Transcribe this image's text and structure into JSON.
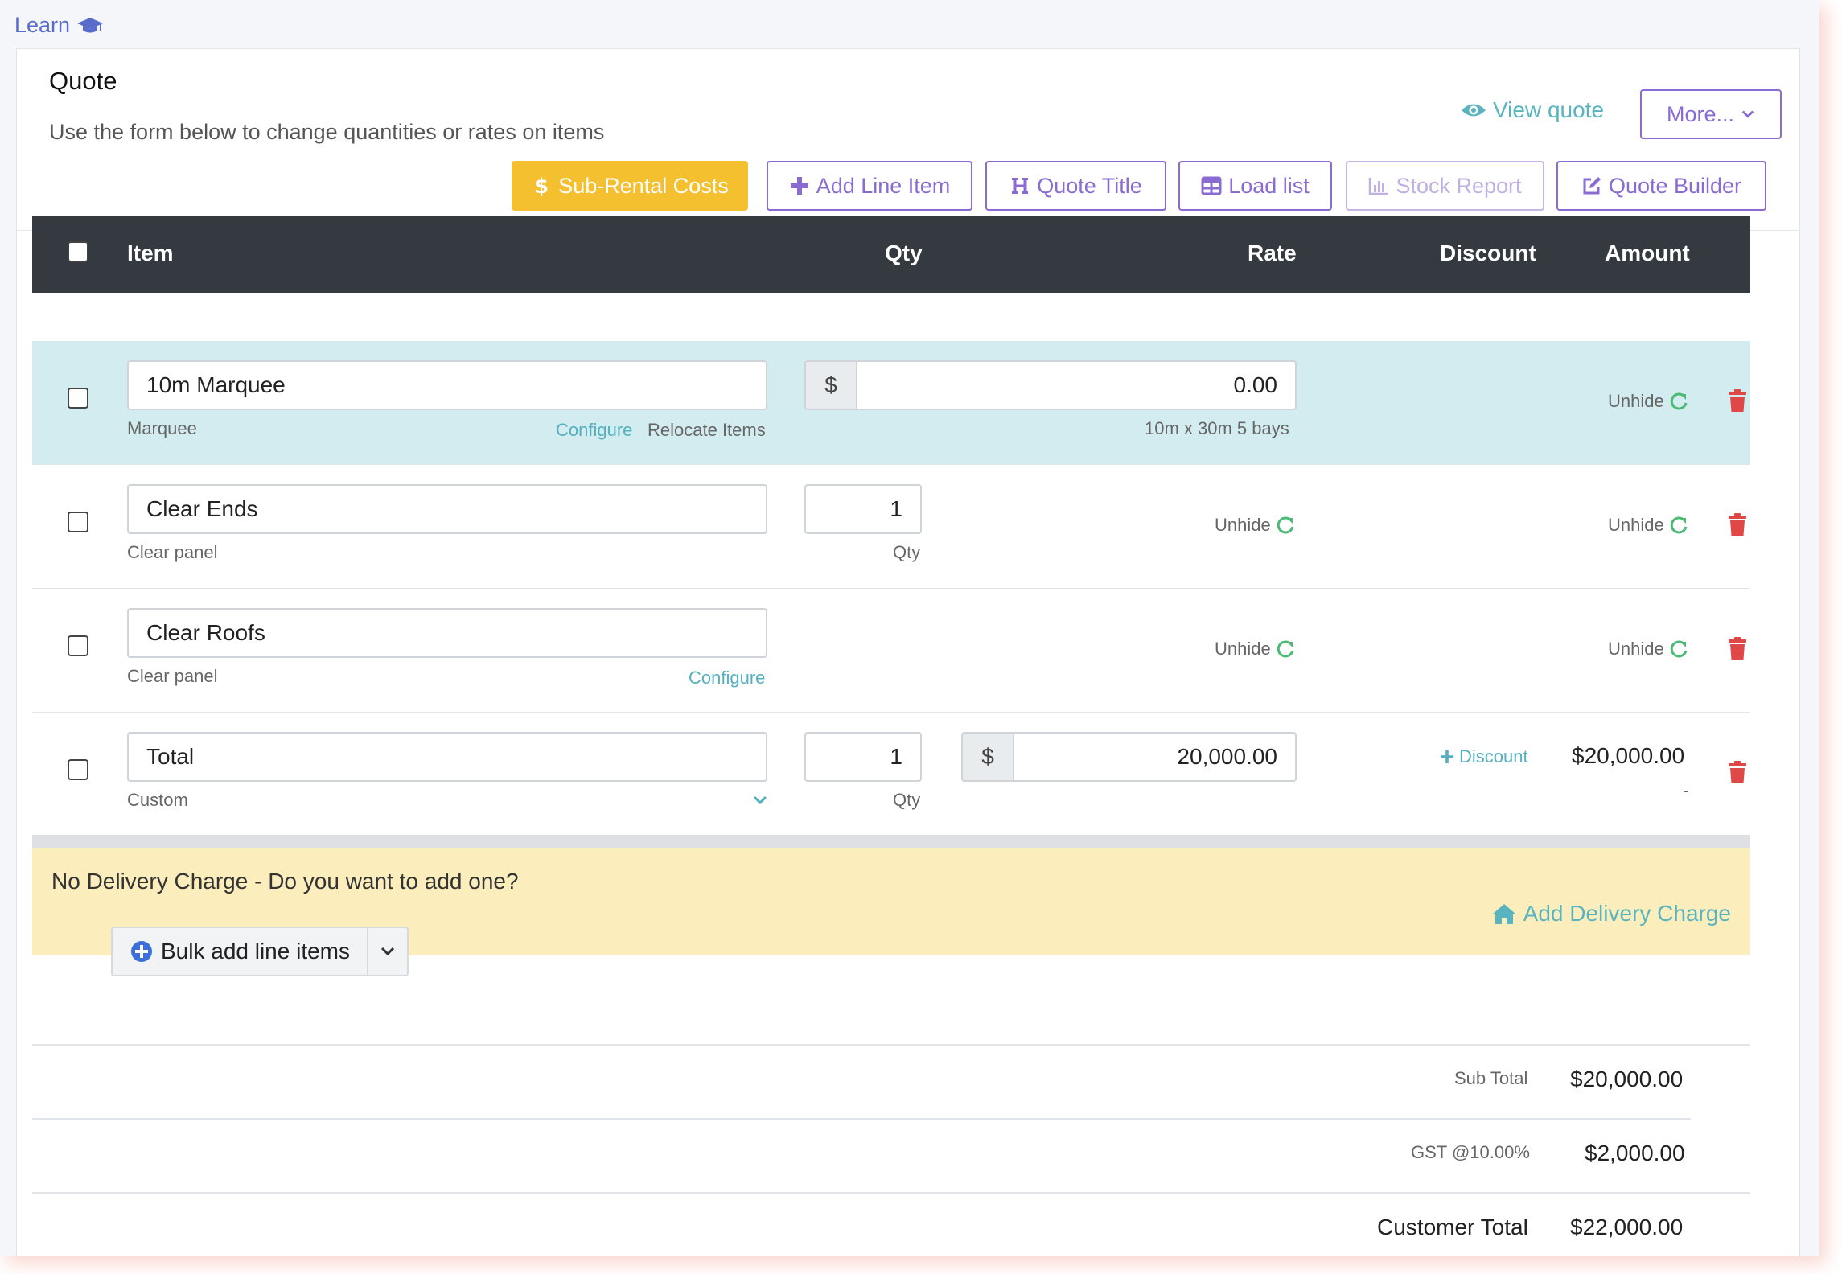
{
  "learn": {
    "label": "Learn"
  },
  "header": {
    "title": "Quote",
    "subtitle": "Use the form below to change quantities or rates on items",
    "view_quote": "View quote",
    "more": "More...",
    "buttons": {
      "sub_rental": "Sub-Rental Costs",
      "add_line": "Add Line Item",
      "quote_title": "Quote Title",
      "load_list": "Load list",
      "stock_report": "Stock Report",
      "quote_builder": "Quote Builder"
    }
  },
  "table": {
    "headers": {
      "item": "Item",
      "qty": "Qty",
      "rate": "Rate",
      "discount": "Discount",
      "amount": "Amount"
    },
    "rows": [
      {
        "name": "10m Marquee",
        "sub": "Marquee",
        "configure": "Configure",
        "relocate": "Relocate Items",
        "currency": "$",
        "rate": "0.00",
        "rate_note": "10m x 30m 5 bays",
        "amount_action": "Unhide"
      },
      {
        "name": "Clear Ends",
        "sub": "Clear panel",
        "qty": "1",
        "qty_label": "Qty",
        "rate_action": "Unhide",
        "amount_action": "Unhide"
      },
      {
        "name": "Clear Roofs",
        "sub": "Clear panel",
        "configure": "Configure",
        "rate_action": "Unhide",
        "amount_action": "Unhide"
      },
      {
        "name": "Total",
        "sub": "Custom",
        "qty": "1",
        "qty_label": "Qty",
        "currency": "$",
        "rate": "20,000.00",
        "discount": "Discount",
        "amount": "$20,000.00",
        "amount_note": "-"
      }
    ]
  },
  "delivery": {
    "question": "No Delivery Charge - Do you want to add one?",
    "add": "Add Delivery Charge"
  },
  "bulk": {
    "label": "Bulk add line items"
  },
  "totals": {
    "sub_total_label": "Sub Total",
    "sub_total": "$20,000.00",
    "gst_label": "GST @10.00%",
    "gst": "$2,000.00",
    "customer_total_label": "Customer Total",
    "customer_total": "$22,000.00"
  },
  "colors": {
    "accent": "#8a6bd2",
    "teal": "#5ab4bf",
    "yellow": "#f4c02f",
    "danger": "#e04848",
    "header_dark": "#343a40"
  }
}
